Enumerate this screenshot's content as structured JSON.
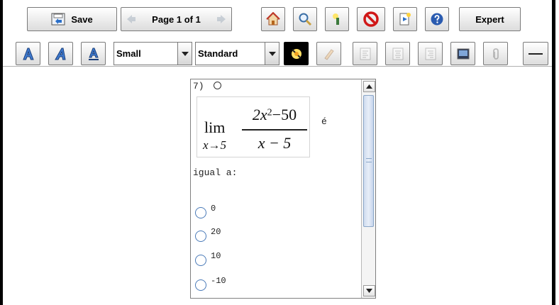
{
  "toolbar": {
    "save_label": "Save",
    "page_indicator": "Page 1 of 1",
    "expert_label": "Expert",
    "font_size": {
      "selected": "Small"
    },
    "font_style": {
      "selected": "Standard"
    }
  },
  "question": {
    "number": "7)",
    "math_prefix": "lim",
    "math_sub": "x→5",
    "numerator_base": "2x",
    "numerator_exp": "2",
    "numerator_rest": "−50",
    "denominator": "x − 5",
    "trailing": "é",
    "continuation": "igual a:",
    "options": [
      "0",
      "20",
      "10",
      "-10"
    ]
  },
  "colors": {
    "radio_border": "#4a7ab8",
    "scroll_thumb": "#cfdcef",
    "stop_red": "#d01818",
    "help_blue": "#2a5bb0"
  },
  "icons": {
    "save": "save-icon",
    "prev": "arrow-left-icon",
    "next": "arrow-right-icon",
    "home": "home-icon",
    "zoom": "magnifier-icon",
    "highlight": "highlighter-icon",
    "stop": "stop-icon",
    "notes": "notes-icon",
    "help": "help-icon"
  }
}
